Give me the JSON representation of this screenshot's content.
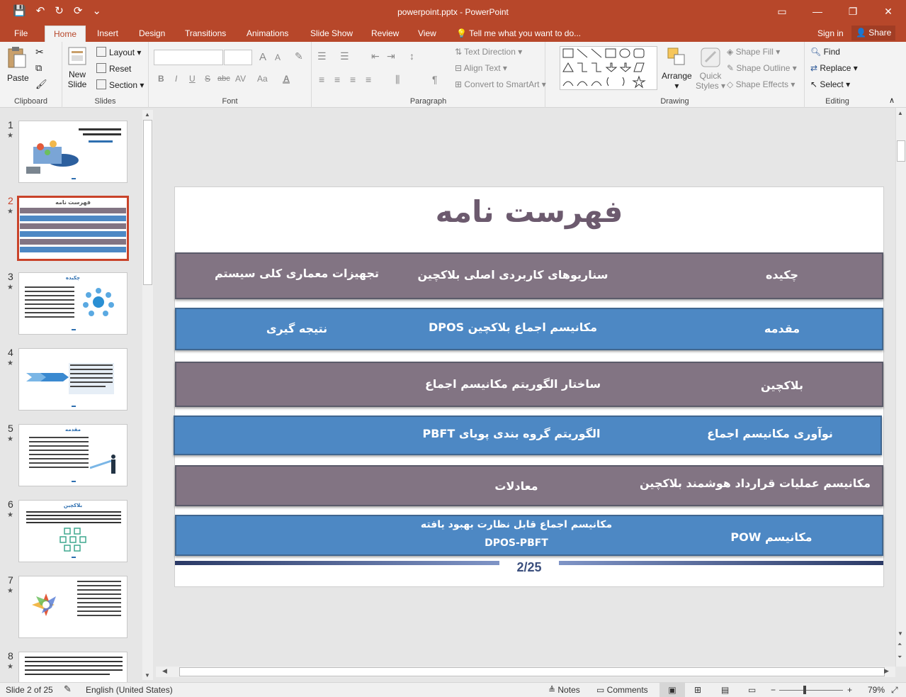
{
  "titlebar": {
    "title": "powerpoint.pptx - PowerPoint",
    "qat": [
      "💾",
      "↶",
      "↻",
      "⟳",
      "⌄"
    ],
    "window_controls": [
      "▭",
      "—",
      "❐",
      "✕"
    ]
  },
  "tabs": {
    "file": "File",
    "items": [
      "Home",
      "Insert",
      "Design",
      "Transitions",
      "Animations",
      "Slide Show",
      "Review",
      "View"
    ],
    "tell_me": "Tell me what you want to do...",
    "sign_in": "Sign in",
    "share": "Share"
  },
  "ribbon": {
    "clipboard": {
      "label": "Clipboard",
      "paste": "Paste"
    },
    "slides": {
      "label": "Slides",
      "new_slide_1": "New",
      "new_slide_2": "Slide",
      "layout": "Layout",
      "reset": "Reset",
      "section": "Section"
    },
    "font": {
      "label": "Font",
      "bold": "B",
      "italic": "I",
      "underline": "U",
      "strike": "S",
      "abc": "abc",
      "av": "AV",
      "aa": "Aa",
      "grow": "A",
      "shrink": "A"
    },
    "paragraph": {
      "label": "Paragraph",
      "text_direction": "Text Direction",
      "align_text": "Align Text",
      "convert_smartart": "Convert to SmartArt"
    },
    "drawing": {
      "label": "Drawing",
      "arrange": "Arrange",
      "quick_styles_1": "Quick",
      "quick_styles_2": "Styles",
      "shape_fill": "Shape Fill",
      "shape_outline": "Shape Outline",
      "shape_effects": "Shape Effects"
    },
    "editing": {
      "label": "Editing",
      "find": "Find",
      "replace": "Replace",
      "select": "Select"
    }
  },
  "thumbnails": [
    "1",
    "2",
    "3",
    "4",
    "5",
    "6",
    "7",
    "8"
  ],
  "thumb_titles": {
    "t1a": "سنتاریسم اجماع بلاکچین",
    "t2": "فهرست نامه",
    "t3": "چکیده",
    "t5": "مقدمه",
    "t6": "بلاکچین"
  },
  "slide": {
    "title": "فهرست نامه",
    "rows": [
      {
        "c1": "چکیده",
        "c2": "سناریوهای کاربردی اصلی بلاکچین",
        "c3": "تجهیزات معماری کلی سیستم"
      },
      {
        "c1": "مقدمه",
        "c2": "مکانیسم اجماع بلاکچین  DPOS",
        "c3": "نتیجه گیری"
      },
      {
        "c1": "بلاکچین",
        "c2": "ساختار الگوریتم مکانیسم اجماع",
        "c3": ""
      },
      {
        "c1": "نوآوری مکانیسم اجماع",
        "c2": "الگوریتم گروه بندی پویای  PBFT",
        "c3": ""
      },
      {
        "c1": "مکانیسم عملیات قرارداد هوشمند بلاکچین",
        "c2": "معادلات",
        "c3": ""
      },
      {
        "c1": "مکانیسم POW",
        "c2a": "مکانیسم اجماع قابل نظارت بهبود یافته",
        "c2b": "DPOS-PBFT",
        "c3": ""
      }
    ],
    "page": "2/25"
  },
  "status": {
    "slide_of": "Slide 2 of 25",
    "language": "English (United States)",
    "notes": "Notes",
    "comments": "Comments",
    "zoom": "79%"
  },
  "colors": {
    "accent": "#b7472a",
    "mauve": "#827483",
    "blue": "#4d88c4",
    "title": "#6c5a6e"
  }
}
